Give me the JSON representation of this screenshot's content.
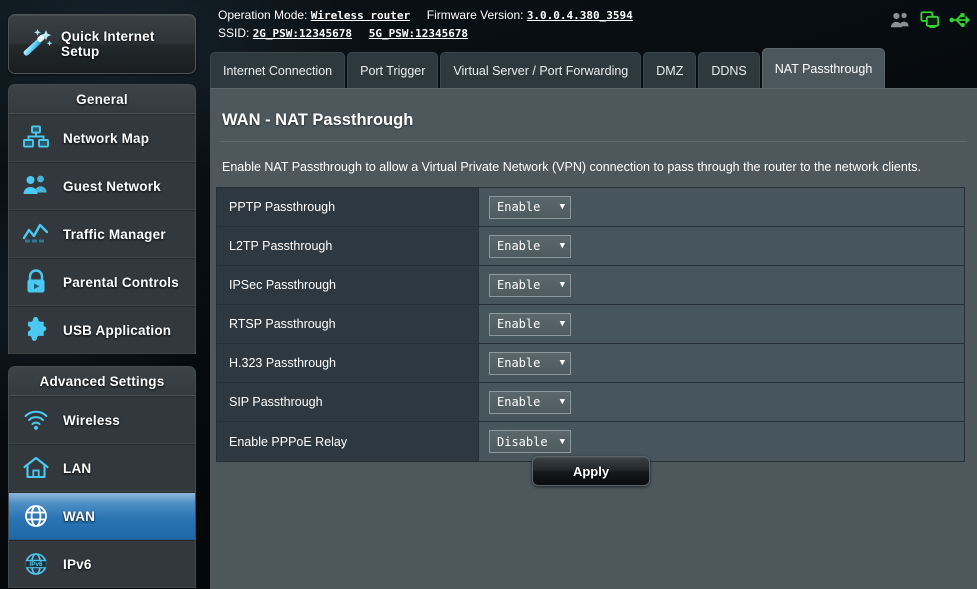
{
  "header": {
    "operation_mode_label": "Operation Mode:",
    "operation_mode_value": "Wireless router",
    "firmware_label": "Firmware Version:",
    "firmware_value": "3.0.0.4.380_3594",
    "ssid_label": "SSID:",
    "ssid_2g": "2G_PSW:12345678",
    "ssid_5g": "5G_PSW:12345678",
    "status_icons": [
      {
        "name": "clients-icon",
        "color": "#8a9194"
      },
      {
        "name": "usb-devices-icon",
        "color": "#35d135"
      },
      {
        "name": "usb-icon",
        "color": "#35d135"
      }
    ]
  },
  "sidebar": {
    "quick_setup": {
      "label": "Quick Internet Setup",
      "icon": "magic-wand-icon"
    },
    "groups": [
      {
        "title": "General",
        "items": [
          {
            "label": "Network Map",
            "icon": "network-map-icon",
            "active": false
          },
          {
            "label": "Guest Network",
            "icon": "guest-network-icon",
            "active": false
          },
          {
            "label": "Traffic Manager",
            "icon": "traffic-manager-icon",
            "active": false
          },
          {
            "label": "Parental Controls",
            "icon": "parental-controls-icon",
            "active": false
          },
          {
            "label": "USB Application",
            "icon": "usb-application-icon",
            "active": false
          }
        ]
      },
      {
        "title": "Advanced Settings",
        "items": [
          {
            "label": "Wireless",
            "icon": "wireless-icon",
            "active": false
          },
          {
            "label": "LAN",
            "icon": "lan-home-icon",
            "active": false
          },
          {
            "label": "WAN",
            "icon": "wan-globe-icon",
            "active": true
          },
          {
            "label": "IPv6",
            "icon": "ipv6-icon",
            "active": false
          }
        ]
      }
    ]
  },
  "tabs": [
    {
      "label": "Internet Connection",
      "active": false
    },
    {
      "label": "Port Trigger",
      "active": false
    },
    {
      "label": "Virtual Server / Port Forwarding",
      "active": false
    },
    {
      "label": "DMZ",
      "active": false
    },
    {
      "label": "DDNS",
      "active": false
    },
    {
      "label": "NAT Passthrough",
      "active": true
    }
  ],
  "main": {
    "title": "WAN - NAT Passthrough",
    "description": "Enable NAT Passthrough to allow a Virtual Private Network (VPN) connection to pass through the router to the network clients.",
    "settings": [
      {
        "label": "PPTP Passthrough",
        "value": "Enable"
      },
      {
        "label": "L2TP Passthrough",
        "value": "Enable"
      },
      {
        "label": "IPSec Passthrough",
        "value": "Enable"
      },
      {
        "label": "RTSP Passthrough",
        "value": "Enable"
      },
      {
        "label": "H.323 Passthrough",
        "value": "Enable"
      },
      {
        "label": "SIP Passthrough",
        "value": "Enable"
      },
      {
        "label": "Enable PPPoE Relay",
        "value": "Disable"
      }
    ],
    "dropdown_caret": "▼",
    "apply_label": "Apply"
  },
  "colors": {
    "accent_blue": "#2a74b4",
    "icon_cyan": "#45c8f0",
    "panel_bg": "#4e585c",
    "label_cell_bg": "#2e3840",
    "value_cell_bg": "#47555c",
    "status_green": "#35d135"
  }
}
